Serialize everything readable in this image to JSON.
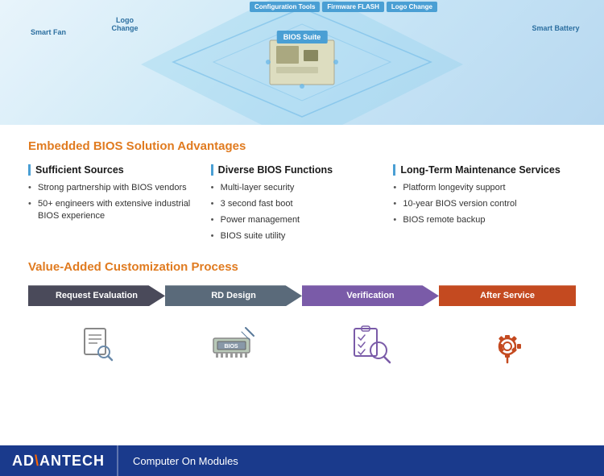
{
  "diagram": {
    "tools": [
      "Configuration Tools",
      "Firmware FLASH",
      "Logo Change"
    ],
    "bios_suite": "BIOS Suite",
    "side_labels": {
      "smart_fan": "Smart Fan",
      "logo_change": "Logo Change",
      "smart_battery": "Smart Battery"
    }
  },
  "section1": {
    "title": "Embedded BIOS Solution Advantages"
  },
  "col1": {
    "title": "Sufficient Sources",
    "items": [
      "Strong partnership with BIOS vendors",
      "50+ engineers with extensive industrial BIOS experience"
    ]
  },
  "col2": {
    "title": "Diverse BIOS Functions",
    "items": [
      "Multi-layer security",
      "3 second fast boot",
      "Power management",
      "BIOS suite utility"
    ]
  },
  "col3": {
    "title": "Long-Term Maintenance Services",
    "items": [
      "Platform longevity support",
      "10-year BIOS version control",
      "BIOS remote backup"
    ]
  },
  "section2": {
    "title": "Value-Added Customization Process"
  },
  "steps": [
    {
      "id": "step1",
      "label": "Request Evaluation",
      "color": "#4a4a5a"
    },
    {
      "id": "step2",
      "label": "RD Design",
      "color": "#5a5a6a"
    },
    {
      "id": "step3",
      "label": "Verification",
      "color": "#7a5ba8"
    },
    {
      "id": "step4",
      "label": "After Service",
      "color": "#c44a20"
    }
  ],
  "footer": {
    "logo_prefix": "AD",
    "logo_accent": "\\",
    "logo_suffix": "ANTECH",
    "subtitle": "Computer On Modules"
  }
}
